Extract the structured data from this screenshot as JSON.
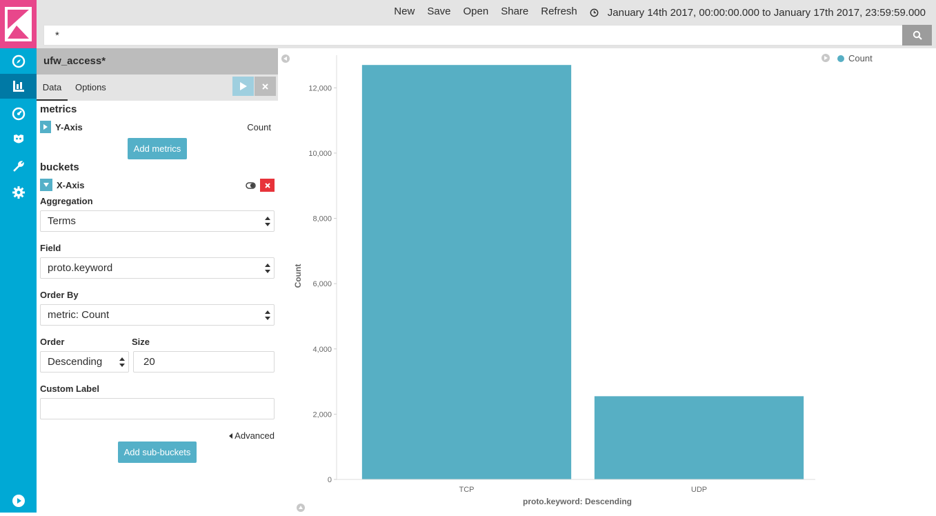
{
  "topbar": {
    "menu": [
      "New",
      "Save",
      "Open",
      "Share",
      "Refresh"
    ],
    "time_range": "January 14th 2017, 00:00:00.000 to January 17th 2017, 23:59:59.000"
  },
  "search": {
    "query": "*"
  },
  "sidebar": {
    "index_pattern": "ufw_access*",
    "tabs": [
      "Data",
      "Options"
    ],
    "metrics_title": "metrics",
    "y_axis_label": "Y-Axis",
    "y_axis_agg": "Count",
    "add_metrics": "Add metrics",
    "buckets_title": "buckets",
    "x_axis_label": "X-Axis",
    "aggregation_label": "Aggregation",
    "aggregation_value": "Terms",
    "field_label": "Field",
    "field_value": "proto.keyword",
    "order_by_label": "Order By",
    "order_by_value": "metric: Count",
    "order_label": "Order",
    "order_value": "Descending",
    "size_label": "Size",
    "size_value": "20",
    "custom_label_label": "Custom Label",
    "custom_label_value": "",
    "advanced": "Advanced",
    "add_sub_buckets": "Add sub-buckets"
  },
  "colors": {
    "accent": "#00a9d5",
    "brand": "#e8478b",
    "bar": "#57afc4",
    "button": "#54b0c8"
  },
  "chart_data": {
    "type": "bar",
    "categories": [
      "TCP",
      "UDP"
    ],
    "series": [
      {
        "name": "Count",
        "values": [
          12700,
          2550
        ]
      }
    ],
    "xlabel": "proto.keyword: Descending",
    "ylabel": "Count",
    "ylim": [
      0,
      13000
    ],
    "yticks": [
      0,
      2000,
      4000,
      6000,
      8000,
      10000,
      12000
    ],
    "ytick_labels": [
      "0",
      "2,000",
      "4,000",
      "6,000",
      "8,000",
      "10,000",
      "12,000"
    ],
    "legend": "top-right",
    "grid": false
  }
}
